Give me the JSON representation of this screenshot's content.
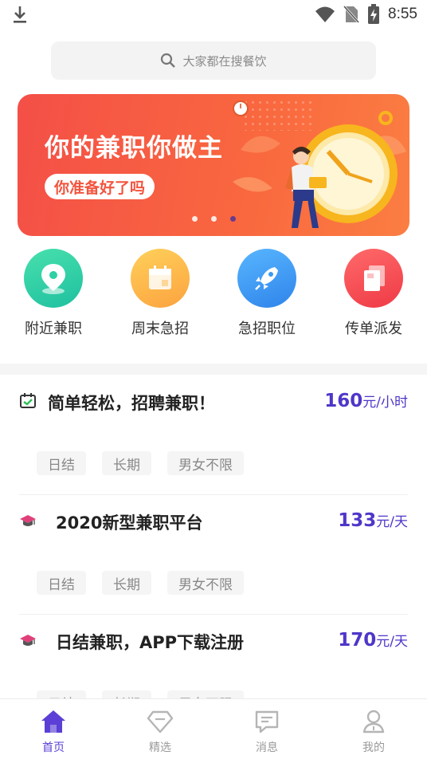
{
  "status_bar": {
    "time": "8:55"
  },
  "search": {
    "placeholder": "大家都在搜餐饮"
  },
  "banner": {
    "title": "你的兼职你做主",
    "subtitle": "你准备好了吗",
    "dots": 3,
    "active_dot": 2
  },
  "categories": [
    {
      "label": "附近兼职",
      "icon": "location-pin-icon",
      "color": "#2fd0a4"
    },
    {
      "label": "周末急招",
      "icon": "calendar-icon",
      "color": "#fcb84e"
    },
    {
      "label": "急招职位",
      "icon": "rocket-icon",
      "color": "#3a9af2"
    },
    {
      "label": "传单派发",
      "icon": "flyer-icon",
      "color": "#f44a4f"
    }
  ],
  "jobs": [
    {
      "icon": "calendar-check-icon",
      "title": "简单轻松，招聘兼职！",
      "pay": "160",
      "unit": "元/小时",
      "tags": [
        "日结",
        "长期",
        "男女不限"
      ]
    },
    {
      "icon": "graduation-cap-icon",
      "title": "2020新型兼职平台",
      "pay": "133",
      "unit": "元/天",
      "tags": [
        "日结",
        "长期",
        "男女不限"
      ]
    },
    {
      "icon": "graduation-cap-icon",
      "title": "日结兼职，APP下载注册",
      "pay": "170",
      "unit": "元/天",
      "tags": [
        "日结",
        "长期",
        "男女不限"
      ]
    }
  ],
  "nav": [
    {
      "label": "首页",
      "icon": "home-icon",
      "active": true
    },
    {
      "label": "精选",
      "icon": "diamond-icon",
      "active": false
    },
    {
      "label": "消息",
      "icon": "message-icon",
      "active": false
    },
    {
      "label": "我的",
      "icon": "person-icon",
      "active": false
    }
  ],
  "colors": {
    "accent": "#5b3fd6",
    "pay": "#5036c9",
    "banner": "#f6533f"
  }
}
